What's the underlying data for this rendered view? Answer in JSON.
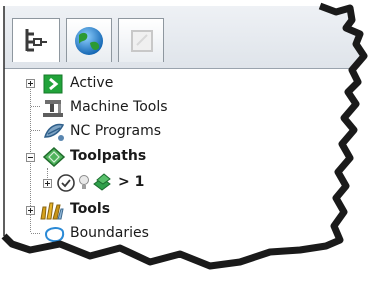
{
  "toolbar": {
    "tabs": [
      {
        "icon": "explorer-tree-icon",
        "active": true
      },
      {
        "icon": "globe-icon",
        "active": false
      },
      {
        "icon": "blank-page-icon",
        "active": false
      }
    ]
  },
  "tree": {
    "items": [
      {
        "label": "Active",
        "icon": "active-arrow-icon",
        "expander": "plus",
        "bold": false
      },
      {
        "label": "Machine Tools",
        "icon": "machine-tool-icon",
        "expander": null,
        "bold": false
      },
      {
        "label": "NC Programs",
        "icon": "nc-programs-icon",
        "expander": null,
        "bold": false
      },
      {
        "label": "Toolpaths",
        "icon": "toolpaths-icon",
        "expander": "minus",
        "bold": true
      },
      {
        "label": "> 1",
        "icon": "toolpath-status-icons",
        "expander": "plus",
        "bold": true
      },
      {
        "label": "Tools",
        "icon": "tools-icon",
        "expander": "plus",
        "bold": true
      },
      {
        "label": "Boundaries",
        "icon": "boundary-icon",
        "expander": null,
        "bold": false
      }
    ]
  },
  "colors": {
    "active_green": "#21a33a",
    "toolpath_green": "#2f9f4a",
    "boundary_blue": "#2b8ad6",
    "tab_border": "#8e979f"
  }
}
